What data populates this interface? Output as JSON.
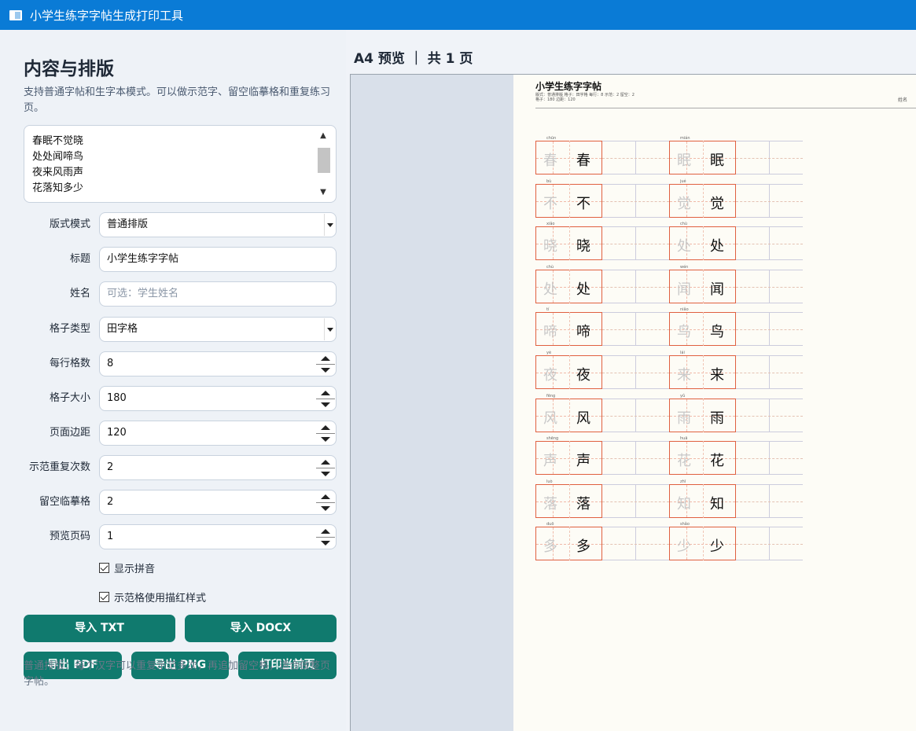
{
  "window": {
    "title": "小学生练字字帖生成打印工具"
  },
  "panel": {
    "heading": "内容与排版",
    "description": "支持普通字帖和生字本模式。可以做示范字、留空临摹格和重复练习页。",
    "text_lines": [
      "春眠不觉晓",
      "处处闻啼鸟",
      "夜来风雨声",
      "花落知多少"
    ]
  },
  "form": {
    "layout_mode": {
      "label": "版式模式",
      "value": "普通排版"
    },
    "title": {
      "label": "标题",
      "value": "小学生练字字帖"
    },
    "name": {
      "label": "姓名",
      "placeholder": "可选：学生姓名"
    },
    "grid_type": {
      "label": "格子类型",
      "value": "田字格"
    },
    "per_row": {
      "label": "每行格数",
      "value": "8"
    },
    "cell_size": {
      "label": "格子大小",
      "value": "180"
    },
    "margin": {
      "label": "页面边距",
      "value": "120"
    },
    "repeat": {
      "label": "示范重复次数",
      "value": "2"
    },
    "blank": {
      "label": "留空临摹格",
      "value": "2"
    },
    "preview_page": {
      "label": "预览页码",
      "value": "1"
    },
    "show_pinyin": {
      "label": "显示拼音",
      "checked": true
    },
    "trace_style": {
      "label": "示范格使用描红样式",
      "checked": true
    }
  },
  "buttons": {
    "import_txt": "导入 TXT",
    "import_docx": "导入 DOCX",
    "export_pdf": "导出 PDF",
    "export_png": "导出 PNG",
    "print": "打印当前页"
  },
  "hint": "普通排版：每个汉字可以重复示范多次，再追加留空格，适合做整页字帖。",
  "preview": {
    "header": "A4 预览 ｜ 共 1 页",
    "page_title": "小学生练字字帖",
    "meta_line1": "版式：普通排版  格子：田字格  每行：8  示范：2  留空：2",
    "meta_line2": "格子：180  边距：120",
    "meta_right": "姓名",
    "columns": [
      [
        {
          "char": "春",
          "pinyin": "chūn"
        },
        {
          "char": "不",
          "pinyin": "bù"
        },
        {
          "char": "晓",
          "pinyin": "xiǎo"
        },
        {
          "char": "处",
          "pinyin": "chù"
        },
        {
          "char": "啼",
          "pinyin": "tí"
        },
        {
          "char": "夜",
          "pinyin": "yè"
        },
        {
          "char": "风",
          "pinyin": "fēng"
        },
        {
          "char": "声",
          "pinyin": "shēng"
        },
        {
          "char": "落",
          "pinyin": "luò"
        },
        {
          "char": "多",
          "pinyin": "duō"
        }
      ],
      [
        {
          "char": "眠",
          "pinyin": "mián"
        },
        {
          "char": "觉",
          "pinyin": "jué"
        },
        {
          "char": "处",
          "pinyin": "chù"
        },
        {
          "char": "闻",
          "pinyin": "wén"
        },
        {
          "char": "鸟",
          "pinyin": "niǎo"
        },
        {
          "char": "来",
          "pinyin": "lái"
        },
        {
          "char": "雨",
          "pinyin": "yǔ"
        },
        {
          "char": "花",
          "pinyin": "huā"
        },
        {
          "char": "知",
          "pinyin": "zhī"
        },
        {
          "char": "少",
          "pinyin": "shǎo"
        }
      ]
    ]
  }
}
